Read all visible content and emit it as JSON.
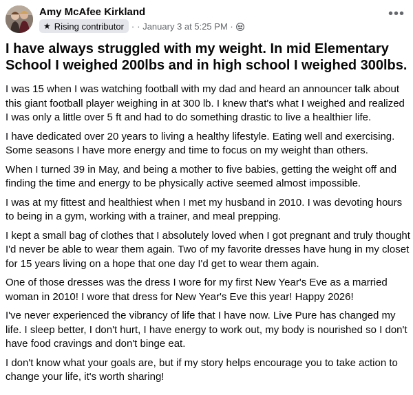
{
  "author": {
    "name": "Amy McAfee Kirkland",
    "badge": "Rising contributor",
    "badge_icon": "star-icon",
    "separator": "·",
    "timestamp": "· January 3 at 5:25 PM ·",
    "audience_icon": "globe-icon"
  },
  "menu": {
    "more_label": "•••"
  },
  "post": {
    "headline": "I have always struggled with my weight. In mid Elementary School I weighed 200lbs and in high school I weighed 300lbs.",
    "paragraphs": [
      "I was 15 when I was watching football with my dad and heard an announcer talk about this giant football player weighing in at 300 lb. I knew that's what I weighed and realized I was only a little over 5 ft and had to do something drastic to live a healthier life.",
      "I have dedicated over 20 years to living a healthy lifestyle. Eating well and exercising. Some seasons I have more energy and time to focus on my weight than others.",
      "When I turned 39 in May, and being a mother to five babies, getting the weight off and finding the time and energy to be physically active seemed almost impossible.",
      "I was at my fittest and healthiest when I met my husband in 2010. I was devoting hours to being in a gym, working with a trainer, and meal prepping.",
      "I kept a small bag of clothes that I absolutely loved when I got pregnant and truly thought I'd never be able to wear them again. Two of my favorite dresses have hung in my closet for 15 years living on a hope that one day I'd get to wear them again.",
      "One of those dresses was the dress I wore for my first New Year's Eve as a married woman in 2010! I wore that dress for New Year's Eve this year! Happy 2026!",
      "I've never experienced the vibrancy of life that I have now. Live Pure has changed my life. I sleep better, I don't hurt, I have energy to work out, my body is nourished so I don't have food cravings and don't binge eat.",
      "I don't know what your goals are, but if my story helps encourage you to take action to change your life, it's worth sharing!"
    ]
  },
  "colors": {
    "text_primary": "#080809",
    "text_secondary": "#65686c",
    "badge_bg": "#e4e6eb",
    "background": "#ffffff"
  }
}
